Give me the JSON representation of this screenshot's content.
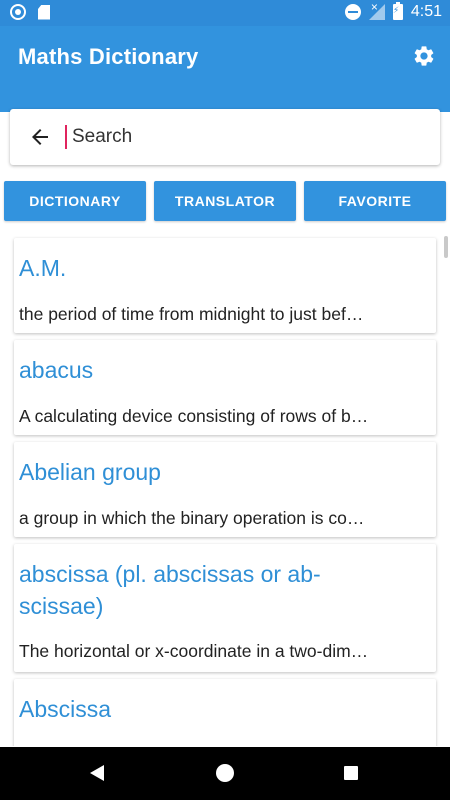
{
  "status_bar": {
    "time": "4:51"
  },
  "app_bar": {
    "title": "Maths Dictionary",
    "settings_icon": "gear-icon"
  },
  "search": {
    "placeholder": "Search",
    "value": ""
  },
  "tabs": [
    {
      "label": "DICTIONARY"
    },
    {
      "label": "TRANSLATOR"
    },
    {
      "label": "FAVORITE"
    }
  ],
  "entries": [
    {
      "term": "A.M.",
      "definition": "the period of time from midnight to just bef…"
    },
    {
      "term": "abacus",
      "definition": "A calculating device consisting of rows of b…"
    },
    {
      "term": "Abelian group",
      "definition": "a group in which the binary operation is co…"
    },
    {
      "term": "abscissa (pl. abscissas or ab-scissae)",
      "term_line1": "abscissa (pl. abscissas or ab-",
      "term_line2": "scissae)",
      "definition": "The horizontal or x-coordinate in a two-dim…"
    },
    {
      "term": "Abscissa",
      "definition": ""
    }
  ],
  "colors": {
    "primary": "#3293de",
    "status": "#2f8bd8",
    "term_text": "#2f8fd6"
  }
}
